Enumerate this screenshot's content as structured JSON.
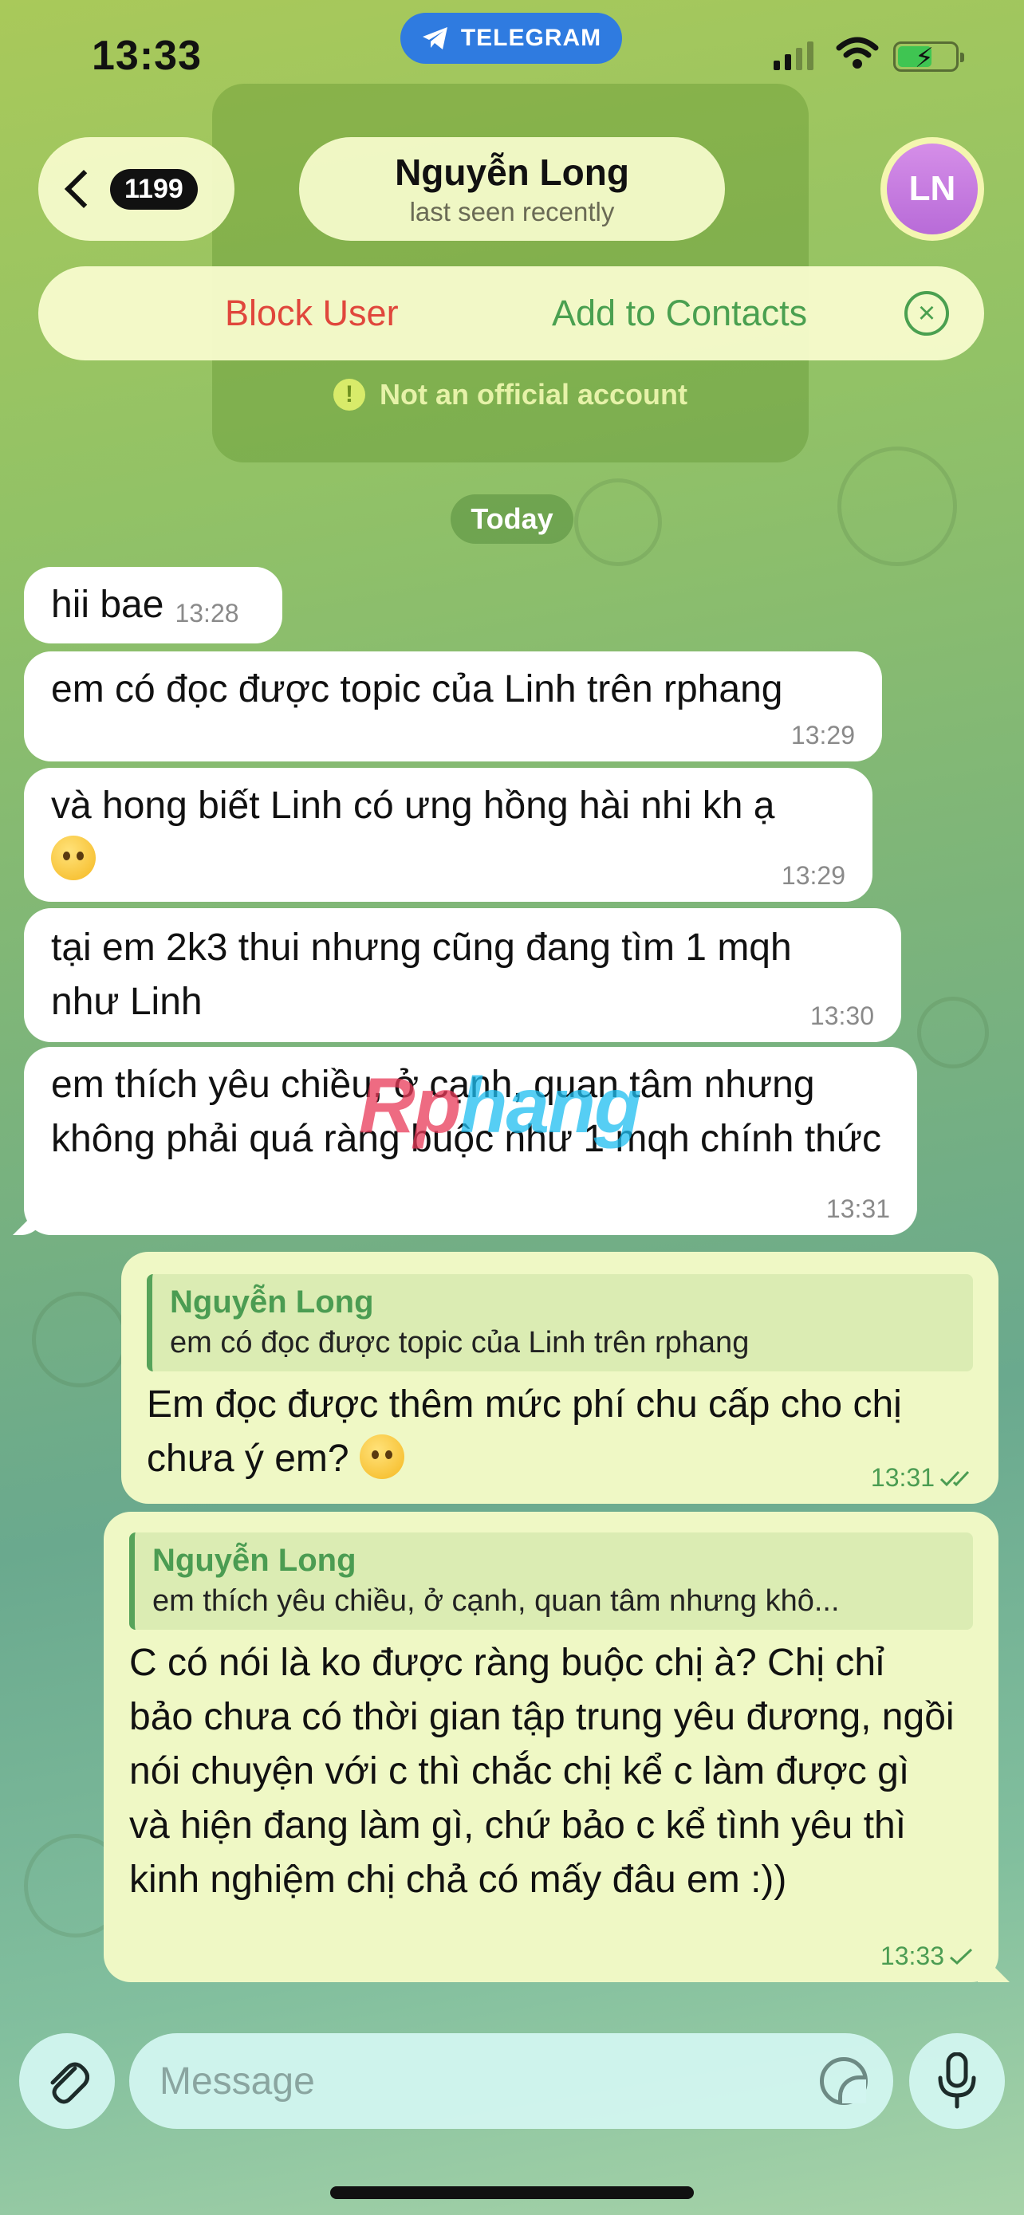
{
  "status_bar": {
    "time": "13:33",
    "app_label": "TELEGRAM"
  },
  "header": {
    "back_count": "1199",
    "contact_name": "Nguyễn Long",
    "last_seen": "last seen recently",
    "avatar_initials": "LN"
  },
  "action_bar": {
    "block_label": "Block User",
    "add_label": "Add to Contacts"
  },
  "notice": "Not an official account",
  "date_label": "Today",
  "incoming": [
    {
      "text": "hii bae",
      "time": "13:28"
    },
    {
      "text": "em có đọc được topic của Linh trên rphang",
      "time": "13:29"
    },
    {
      "text": "và hong biết Linh có ưng hồng hài nhi kh ạ",
      "time": "13:29",
      "emoji": "pleading-face"
    },
    {
      "text": "tại em 2k3 thui nhưng cũng đang tìm 1 mqh như Linh",
      "time": "13:30"
    },
    {
      "text": "em thích yêu chiều, ở cạnh, quan tâm nhưng không phải quá ràng buộc như 1 mqh chính thức",
      "time": "13:31"
    }
  ],
  "outgoing": [
    {
      "reply_name": "Nguyễn Long",
      "reply_text": "em có đọc được topic của Linh trên rphang",
      "text": "Em đọc được thêm mức phí chu cấp cho chị chưa ý em?",
      "emoji": "smiling-face",
      "time": "13:31",
      "status": "read"
    },
    {
      "reply_name": "Nguyễn Long",
      "reply_text": "em thích yêu chiều, ở cạnh, quan tâm nhưng khô...",
      "text": "C có nói là ko được ràng buộc chị à? Chị chỉ bảo chưa có thời gian tập trung yêu đương, ngồi nói chuyện với c thì chắc chị kể c làm được gì và hiện đang làm gì, chứ bảo c kể tình yêu thì kinh nghiệm chị chả có mấy đâu em :))",
      "time": "13:33",
      "status": "sent"
    }
  ],
  "watermark": {
    "part1": "Rp",
    "part2": "hang"
  },
  "composer": {
    "placeholder": "Message"
  },
  "colors": {
    "accent": "#2f7be0",
    "block": "#e0473c",
    "green": "#4aa050",
    "outgoing_bubble": "#eff8c5"
  }
}
